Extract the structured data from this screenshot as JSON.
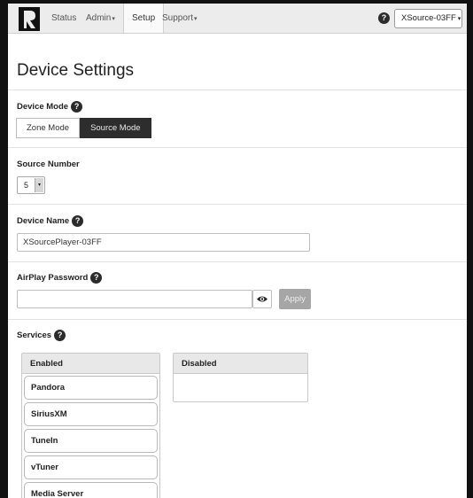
{
  "navbar": {
    "items": [
      {
        "label": "Status"
      },
      {
        "label": "Admin",
        "dropdown": true
      },
      {
        "label": "Setup",
        "active": true
      },
      {
        "label": "Support",
        "dropdown": true
      }
    ],
    "help_icon": "?",
    "device_selector": "XSource-03FF",
    "caret": "▾"
  },
  "page": {
    "title": "Device Settings"
  },
  "device_mode": {
    "label": "Device Mode",
    "options": [
      "Zone Mode",
      "Source Mode"
    ],
    "selected": "Source Mode"
  },
  "source_number": {
    "label": "Source Number",
    "value": "5",
    "arrow": "▾"
  },
  "device_name": {
    "label": "Device Name",
    "value": "XSourcePlayer-03FF"
  },
  "airplay": {
    "label": "AirPlay Password",
    "value": "",
    "apply_label": "Apply"
  },
  "services": {
    "label": "Services",
    "enabled_header": "Enabled",
    "disabled_header": "Disabled",
    "enabled": [
      "Pandora",
      "SiriusXM",
      "TuneIn",
      "vTuner",
      "Media Server"
    ],
    "disabled": []
  },
  "help": "?",
  "colors": {
    "active_button": "#2d2d2d",
    "navbar": "#ececec",
    "apply_disabled": "#a6a6a6"
  }
}
